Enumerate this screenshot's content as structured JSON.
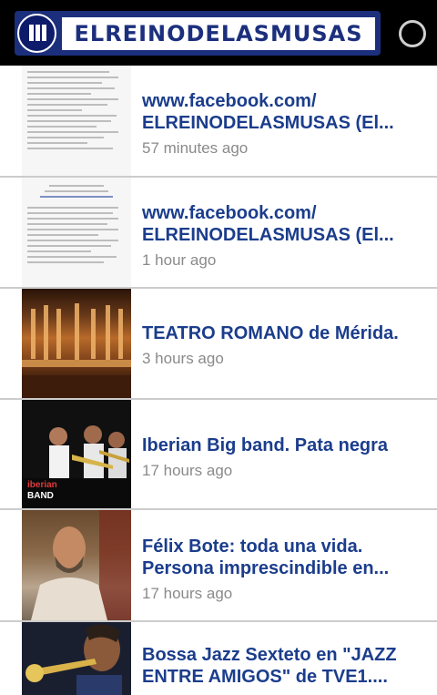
{
  "header": {
    "app_title": "ELREINODELASMUSAS",
    "logo_icon": "mu-logo-icon",
    "refresh_icon": "refresh-spinner-icon"
  },
  "items": [
    {
      "title_line1": "www.facebook.com/",
      "title_line2": "ELREINODELASMUSAS (El...",
      "time": "57 minutes ago",
      "thumb": "document-thumbnail"
    },
    {
      "title_line1": "www.facebook.com/",
      "title_line2": "ELREINODELASMUSAS (El...",
      "time": "1 hour ago",
      "thumb": "document-thumbnail"
    },
    {
      "title_line1": "TEATRO ROMANO de Mérida.",
      "title_line2": "",
      "time": "3 hours ago",
      "thumb": "roman-theatre-photo"
    },
    {
      "title_line1": "Iberian Big band. Pata negra",
      "title_line2": "",
      "time": "17 hours ago",
      "thumb": "big-band-photo"
    },
    {
      "title_line1": "Félix Bote: toda una vida.",
      "title_line2": "Persona imprescindible en...",
      "time": "17 hours ago",
      "thumb": "portrait-photo"
    },
    {
      "title_line1": "Bossa Jazz Sexteto en \"JAZZ",
      "title_line2": "ENTRE AMIGOS\" de TVE1....",
      "time": "",
      "thumb": "trumpet-photo"
    }
  ],
  "colors": {
    "title": "#1b3d8c",
    "time": "#8a8a8a",
    "divider": "#cccccc",
    "header": "#000000",
    "logo_blue": "#1c2f7d"
  }
}
